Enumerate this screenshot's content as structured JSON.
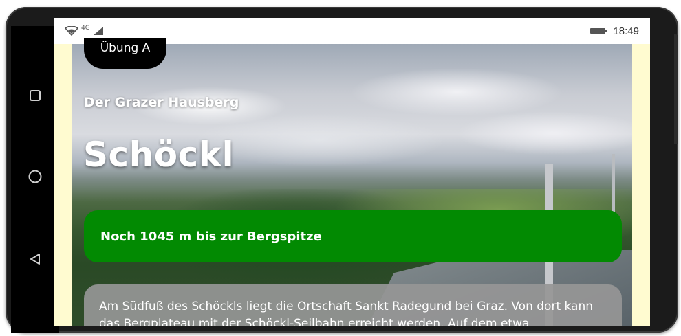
{
  "statusbar": {
    "network": "4G",
    "time": "18:49",
    "icons": [
      "wifi-icon",
      "signal-icon",
      "battery-icon"
    ]
  },
  "navbar": {
    "icons": [
      "recents-square-icon",
      "home-circle-icon",
      "back-triangle-icon"
    ]
  },
  "exercise": {
    "chip_label": "Übung A"
  },
  "hero": {
    "subtitle": "Der Grazer Hausberg",
    "title": "Schöckl"
  },
  "banner": {
    "text": "Noch 1045 m bis zur Bergspitze"
  },
  "description": {
    "text": "Am Südfuß des Schöckls liegt die Ortschaft Sankt Radegund bei Graz. Von dort kann das Bergplateau mit der Schöckl-Seilbahn erreicht werden. Auf dem etwa"
  },
  "colors": {
    "banner": "#028a02",
    "chip": "#000000",
    "screen_bg": "#fffbd0",
    "desc_bg": "#969696"
  }
}
